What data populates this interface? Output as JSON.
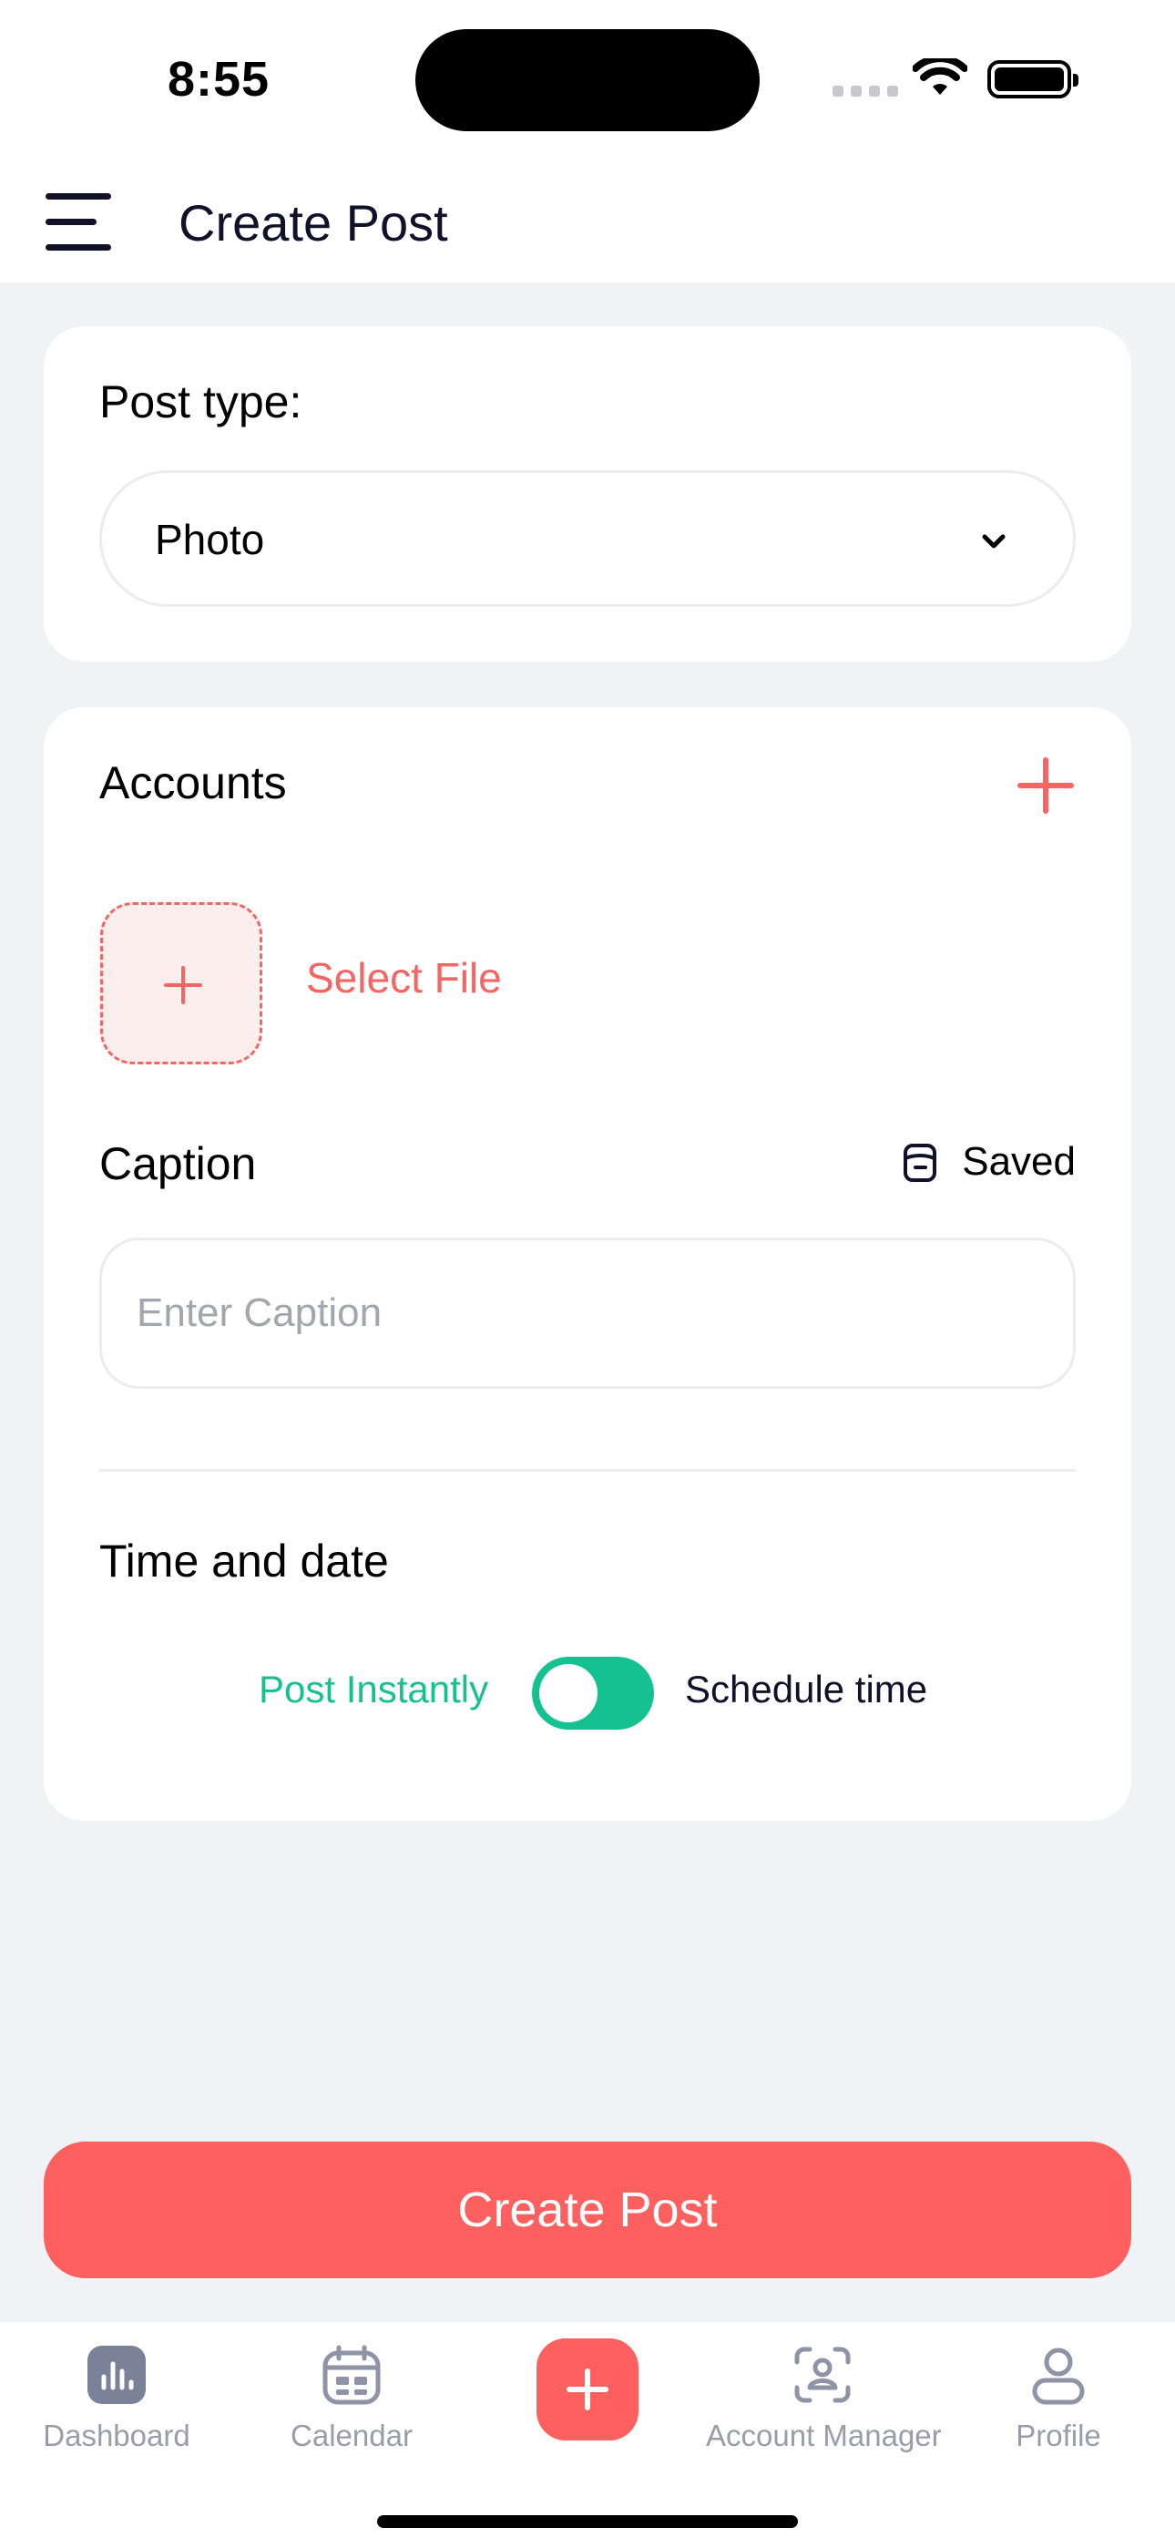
{
  "status_bar": {
    "time": "8:55",
    "icons": [
      "cellular-signal-icon",
      "wifi-icon",
      "battery-icon"
    ]
  },
  "header": {
    "title": "Create Post",
    "icon": "hamburger-menu-icon"
  },
  "post_type": {
    "label": "Post type:",
    "selected_value": "Photo",
    "icon": "chevron-down-icon"
  },
  "accounts": {
    "label": "Accounts",
    "add_icon": "plus-icon",
    "select_file_label": "Select File"
  },
  "caption": {
    "label": "Caption",
    "saved_label": "Saved",
    "saved_icon": "saved-drafts-icon",
    "value": "",
    "placeholder": "Enter Caption"
  },
  "time_and_date": {
    "label": "Time and date",
    "option_left": "Post Instantly",
    "option_right": "Schedule time",
    "selected": "Post Instantly"
  },
  "primary_button": {
    "label": "Create Post"
  },
  "tab_bar": {
    "items": [
      {
        "label": "Dashboard",
        "icon": "bar-chart-icon"
      },
      {
        "label": "Calendar",
        "icon": "calendar-icon"
      },
      {
        "label": "",
        "icon": "plus-icon"
      },
      {
        "label": "Account Manager",
        "icon": "account-manager-icon"
      },
      {
        "label": "Profile",
        "icon": "user-icon"
      }
    ]
  },
  "colors": {
    "accent_red": "#fe5f5f",
    "accent_green": "#16c191",
    "background": "#f1f2f5",
    "text_dark": "#11122a",
    "tab_inactive": "#9a9cab"
  }
}
